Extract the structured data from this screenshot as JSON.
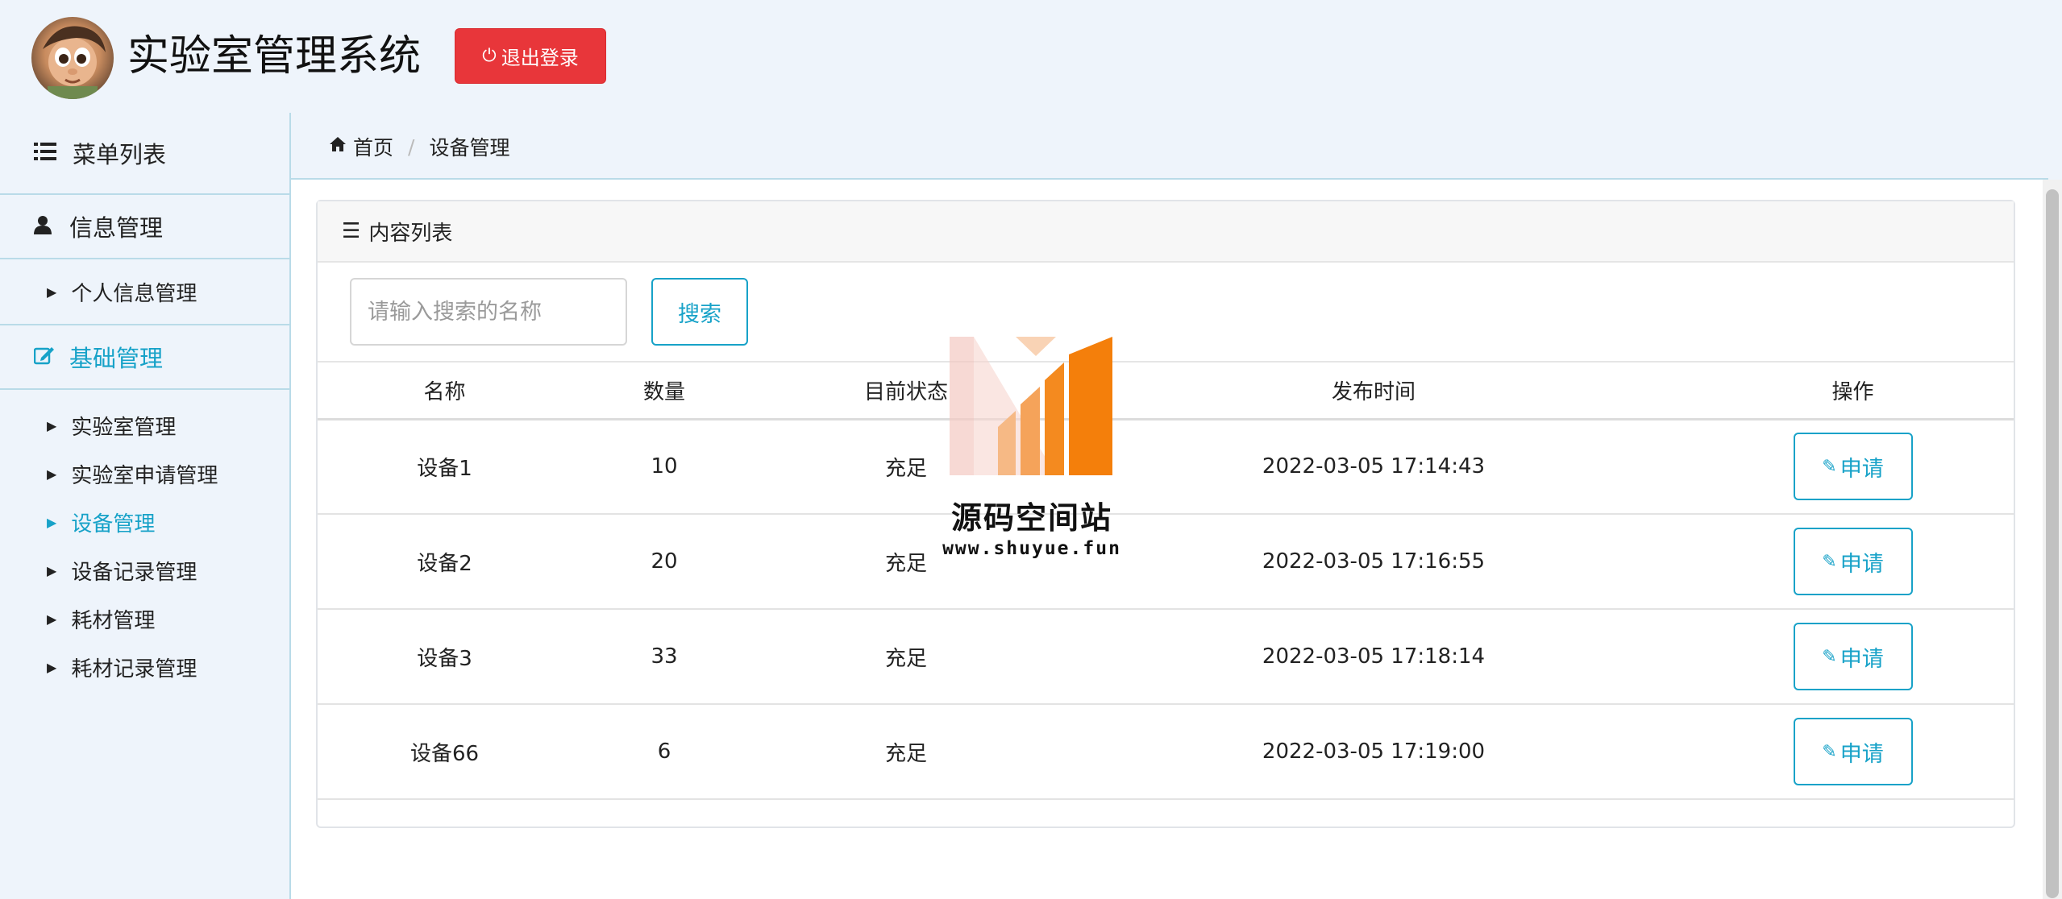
{
  "header": {
    "app_title": "实验室管理系统",
    "logout_label": "退出登录",
    "logout_color": "#e8363a"
  },
  "sidebar": {
    "menu_title": "菜单列表",
    "groups": [
      {
        "label": "信息管理",
        "icon": "user-icon",
        "items": [
          {
            "label": "个人信息管理"
          }
        ]
      },
      {
        "label": "基础管理",
        "icon": "edit-icon",
        "active": true,
        "items": [
          {
            "label": "实验室管理"
          },
          {
            "label": "实验室申请管理"
          },
          {
            "label": "设备管理",
            "active": true
          },
          {
            "label": "设备记录管理"
          },
          {
            "label": "耗材管理"
          },
          {
            "label": "耗材记录管理"
          }
        ]
      }
    ],
    "accent_color": "#17a2c8"
  },
  "breadcrumb": {
    "home": "首页",
    "current": "设备管理"
  },
  "panel": {
    "title": "内容列表",
    "search_placeholder": "请输入搜索的名称",
    "search_label": "搜索"
  },
  "table": {
    "columns": [
      "名称",
      "数量",
      "目前状态",
      "发布时间",
      "操作"
    ],
    "rows": [
      {
        "name": "设备1",
        "qty": "10",
        "status": "充足",
        "time": "2022-03-05 17:14:43",
        "action": "申请"
      },
      {
        "name": "设备2",
        "qty": "20",
        "status": "充足",
        "time": "2022-03-05 17:16:55",
        "action": "申请"
      },
      {
        "name": "设备3",
        "qty": "33",
        "status": "充足",
        "time": "2022-03-05 17:18:14",
        "action": "申请"
      },
      {
        "name": "设备66",
        "qty": "6",
        "status": "充足",
        "time": "2022-03-05 17:19:00",
        "action": "申请"
      }
    ]
  },
  "watermark": {
    "title": "源码空间站",
    "url": "www.shuyue.fun"
  }
}
